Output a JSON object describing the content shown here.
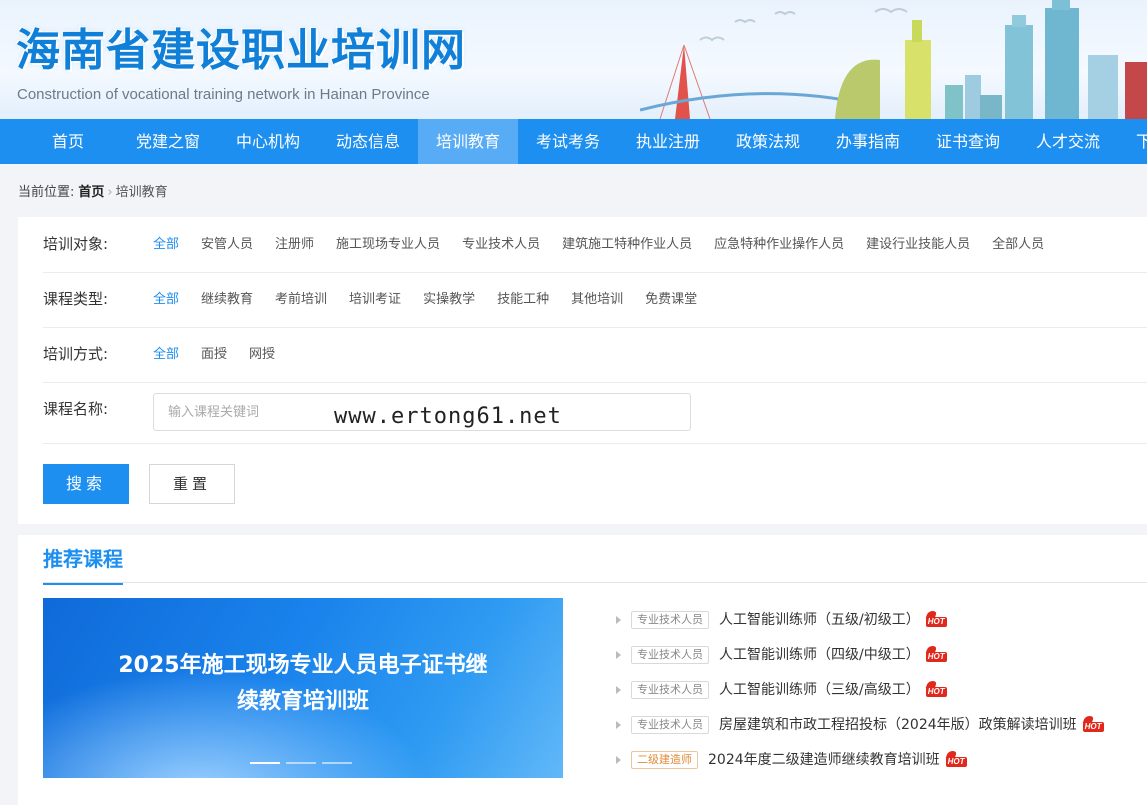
{
  "header": {
    "title": "海南省建设职业培训网",
    "subtitle": "Construction of vocational training network in Hainan Province"
  },
  "nav": {
    "items": [
      "首页",
      "党建之窗",
      "中心机构",
      "动态信息",
      "培训教育",
      "考试考务",
      "执业注册",
      "政策法规",
      "办事指南",
      "证书查询",
      "人才交流",
      "下"
    ],
    "active_index": 4
  },
  "breadcrumb": {
    "prefix": "当前位置:",
    "home": "首页",
    "separator": "›",
    "current": "培训教育"
  },
  "filters": {
    "target": {
      "label": "培训对象:",
      "options": [
        "全部",
        "安管人员",
        "注册师",
        "施工现场专业人员",
        "专业技术人员",
        "建筑施工特种作业人员",
        "应急特种作业操作人员",
        "建设行业技能人员",
        "全部人员"
      ],
      "active_index": 0
    },
    "course_type": {
      "label": "课程类型:",
      "options": [
        "全部",
        "继续教育",
        "考前培训",
        "培训考证",
        "实操教学",
        "技能工种",
        "其他培训",
        "免费课堂"
      ],
      "active_index": 0
    },
    "method": {
      "label": "培训方式:",
      "options": [
        "全部",
        "面授",
        "网授"
      ],
      "active_index": 0
    },
    "course_name": {
      "label": "课程名称:",
      "placeholder": "输入课程关键词"
    },
    "search_button": "搜索",
    "reset_button": "重置"
  },
  "recommended": {
    "title": "推荐课程",
    "carousel": {
      "line1": "2025年施工现场专业人员电子证书继",
      "line2": "续教育培训班",
      "slide_count": 3,
      "active_slide": 0
    },
    "courses": [
      {
        "tag": "专业技术人员",
        "tag_color": "gray",
        "name": "人工智能训练师（五级/初级工）",
        "hot": "HOT"
      },
      {
        "tag": "专业技术人员",
        "tag_color": "gray",
        "name": "人工智能训练师（四级/中级工）",
        "hot": "HOT"
      },
      {
        "tag": "专业技术人员",
        "tag_color": "gray",
        "name": "人工智能训练师（三级/高级工）",
        "hot": "HOT"
      },
      {
        "tag": "专业技术人员",
        "tag_color": "gray",
        "name": "房屋建筑和市政工程招投标（2024年版）政策解读培训班",
        "hot": "HOT"
      },
      {
        "tag": "二级建造师",
        "tag_color": "orange",
        "name": "2024年度二级建造师继续教育培训班",
        "hot": "HOT"
      }
    ]
  },
  "watermark": "www.ertong61.net",
  "colors": {
    "primary": "#1c8ff0",
    "nav_active": "#58acf5",
    "tag_orange": "#e08a3a",
    "hot_red": "#e0281c"
  }
}
